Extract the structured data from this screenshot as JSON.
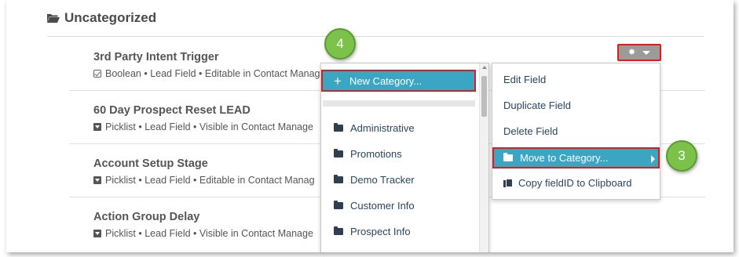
{
  "section": {
    "title": "Uncategorized",
    "icon": "folder-open-icon"
  },
  "fields": [
    {
      "name": "3rd Party Intent Trigger",
      "icon": "checkbox-icon",
      "meta": "Boolean • Lead Field • Editable in Contact Manag"
    },
    {
      "name": "60 Day Prospect Reset LEAD",
      "icon": "picklist-icon",
      "meta": "Picklist • Lead Field • Visible in Contact Manage"
    },
    {
      "name": "Account Setup Stage",
      "icon": "picklist-icon",
      "meta": "Picklist • Lead Field • Editable in Contact Manag"
    },
    {
      "name": "Action Group Delay",
      "icon": "picklist-icon",
      "meta": "Picklist • Lead Field • Visible in Contact Manage"
    }
  ],
  "gear_button": {
    "icon": "gear-icon",
    "caret": "chevron-down-icon"
  },
  "category_menu": {
    "new_label": "New Category...",
    "items": [
      "Administrative",
      "Promotions",
      "Demo Tracker",
      "Customer Info",
      "Prospect Info"
    ]
  },
  "action_menu": {
    "items": [
      "Edit Field",
      "Duplicate Field",
      "Delete Field"
    ],
    "move_label": "Move to Category...",
    "copy_label": "Copy fieldID to Clipboard"
  },
  "badges": {
    "step3": "3",
    "step4": "4"
  },
  "colors": {
    "highlight": "#3aa6c4",
    "annotation_border": "#e11b1b",
    "badge": "#7cc24a"
  }
}
